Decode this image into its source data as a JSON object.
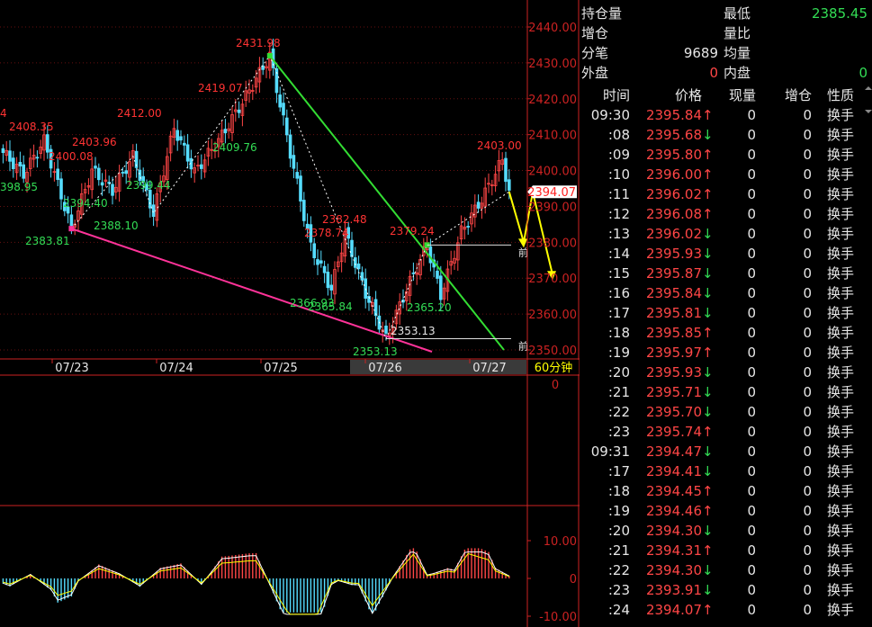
{
  "chart_data": {
    "type": "candlestick",
    "period": "60分钟",
    "y_ticks": [
      "2440.00",
      "2430.00",
      "2420.00",
      "2410.00",
      "2400.00",
      "2390.00",
      "2380.00",
      "2370.00",
      "2360.00",
      "2350.00"
    ],
    "x_ticks": [
      "07/23",
      "07/24",
      "07/25",
      "07/26",
      "07/27"
    ],
    "last_price_label": "2394.07",
    "qian_label": "前",
    "annotations": {
      "high_labels": [
        "4",
        "2408.35",
        "2400.08",
        "2403.96",
        "2412.00",
        "2419.07",
        "2431.98",
        "2382.48",
        "2378.74",
        "2379.24",
        "2403.00"
      ],
      "low_labels": [
        "398.95",
        "2394.40",
        "2399.44",
        "2388.10",
        "2383.81",
        "2409.76",
        "2366.93",
        "2365.84",
        "2365.20",
        "2353.13"
      ],
      "level_labels": [
        "2353.13"
      ]
    },
    "volume_panel": {
      "y_ticks": [
        "0"
      ]
    },
    "macd_panel": {
      "y_ticks": [
        "10.00",
        "0",
        "-10.00"
      ]
    }
  },
  "quote": {
    "open_interest_label": "持仓量",
    "low_label": "最低",
    "low_value": "2385.45",
    "oi_change_label": "增仓",
    "volume_ratio_label": "量比",
    "ticks_label": "分笔",
    "ticks_value": "9689",
    "avg_label": "均量",
    "outer_label": "外盘",
    "outer_value": "0",
    "inner_label": "内盘",
    "inner_value": "0"
  },
  "ticks_table": {
    "headers": {
      "time": "时间",
      "price": "价格",
      "volume": "现量",
      "oi_change": "增仓",
      "nature": "性质"
    },
    "rows": [
      {
        "time": "09:30",
        "price": "2395.84",
        "dir": "up",
        "vol": "0",
        "chg": "0",
        "nature": "换手"
      },
      {
        "time": ":08",
        "price": "2395.68",
        "dir": "dn",
        "vol": "0",
        "chg": "0",
        "nature": "换手"
      },
      {
        "time": ":09",
        "price": "2395.80",
        "dir": "up",
        "vol": "0",
        "chg": "0",
        "nature": "换手"
      },
      {
        "time": ":10",
        "price": "2396.00",
        "dir": "up",
        "vol": "0",
        "chg": "0",
        "nature": "换手"
      },
      {
        "time": ":11",
        "price": "2396.02",
        "dir": "up",
        "vol": "0",
        "chg": "0",
        "nature": "换手"
      },
      {
        "time": ":12",
        "price": "2396.08",
        "dir": "up",
        "vol": "0",
        "chg": "0",
        "nature": "换手"
      },
      {
        "time": ":13",
        "price": "2396.02",
        "dir": "dn",
        "vol": "0",
        "chg": "0",
        "nature": "换手"
      },
      {
        "time": ":14",
        "price": "2395.93",
        "dir": "dn",
        "vol": "0",
        "chg": "0",
        "nature": "换手"
      },
      {
        "time": ":15",
        "price": "2395.87",
        "dir": "dn",
        "vol": "0",
        "chg": "0",
        "nature": "换手"
      },
      {
        "time": ":16",
        "price": "2395.84",
        "dir": "dn",
        "vol": "0",
        "chg": "0",
        "nature": "换手"
      },
      {
        "time": ":17",
        "price": "2395.81",
        "dir": "dn",
        "vol": "0",
        "chg": "0",
        "nature": "换手"
      },
      {
        "time": ":18",
        "price": "2395.85",
        "dir": "up",
        "vol": "0",
        "chg": "0",
        "nature": "换手"
      },
      {
        "time": ":19",
        "price": "2395.97",
        "dir": "up",
        "vol": "0",
        "chg": "0",
        "nature": "换手"
      },
      {
        "time": ":20",
        "price": "2395.93",
        "dir": "dn",
        "vol": "0",
        "chg": "0",
        "nature": "换手"
      },
      {
        "time": ":21",
        "price": "2395.71",
        "dir": "dn",
        "vol": "0",
        "chg": "0",
        "nature": "换手"
      },
      {
        "time": ":22",
        "price": "2395.70",
        "dir": "dn",
        "vol": "0",
        "chg": "0",
        "nature": "换手"
      },
      {
        "time": ":23",
        "price": "2395.74",
        "dir": "up",
        "vol": "0",
        "chg": "0",
        "nature": "换手"
      },
      {
        "time": "09:31",
        "price": "2394.47",
        "dir": "dn",
        "vol": "0",
        "chg": "0",
        "nature": "换手"
      },
      {
        "time": ":17",
        "price": "2394.41",
        "dir": "dn",
        "vol": "0",
        "chg": "0",
        "nature": "换手"
      },
      {
        "time": ":18",
        "price": "2394.45",
        "dir": "up",
        "vol": "0",
        "chg": "0",
        "nature": "换手"
      },
      {
        "time": ":19",
        "price": "2394.46",
        "dir": "up",
        "vol": "0",
        "chg": "0",
        "nature": "换手"
      },
      {
        "time": ":20",
        "price": "2394.30",
        "dir": "dn",
        "vol": "0",
        "chg": "0",
        "nature": "换手"
      },
      {
        "time": ":21",
        "price": "2394.31",
        "dir": "up",
        "vol": "0",
        "chg": "0",
        "nature": "换手"
      },
      {
        "time": ":22",
        "price": "2394.30",
        "dir": "dn",
        "vol": "0",
        "chg": "0",
        "nature": "换手"
      },
      {
        "time": ":23",
        "price": "2393.91",
        "dir": "dn",
        "vol": "0",
        "chg": "0",
        "nature": "换手"
      },
      {
        "time": ":24",
        "price": "2394.07",
        "dir": "up",
        "vol": "0",
        "chg": "0",
        "nature": "换手"
      }
    ]
  },
  "colors": {
    "up": "#ff4646",
    "down": "#33dd55",
    "axis": "#cc2222",
    "accent": "#ffff00"
  }
}
